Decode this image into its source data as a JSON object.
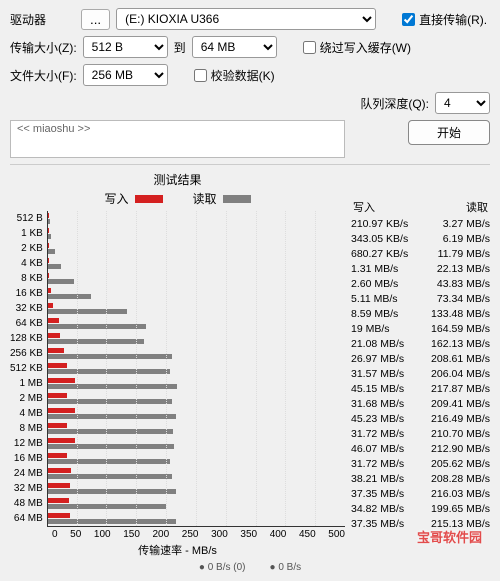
{
  "labels": {
    "drive": "驱动器",
    "transfer_size": "传输大小(Z):",
    "file_size": "文件大小(F):",
    "to": "到",
    "direct_transfer": "直接传输(R).",
    "bypass_write_cache": "绕过写入缓存(W)",
    "verify_data": "校验数据(K)",
    "queue_depth": "队列深度(Q):",
    "start": "开始",
    "write": "写入",
    "read": "读取",
    "test_results": "测试结果",
    "x_axis": "传输速率 - MB/s",
    "dots": "...",
    "desc_placeholder": "<< miaoshu >>",
    "footer_bps": "0 B/s (0)",
    "footer_bs": "0 B/s"
  },
  "values": {
    "drive_selected": "(E:) KIOXIA U366",
    "transfer_min": "512 B",
    "transfer_max": "64 MB",
    "file_size_selected": "256 MB",
    "queue_depth_selected": "4",
    "direct_transfer_checked": true,
    "bypass_checked": false,
    "verify_checked": false
  },
  "watermark": "宝哥软件园",
  "chart_data": {
    "type": "bar",
    "xlabel": "传输速率 - MB/s",
    "xlim": [
      0,
      500
    ],
    "xticks": [
      0,
      50,
      100,
      150,
      200,
      250,
      300,
      350,
      400,
      450,
      500
    ],
    "categories": [
      "512 B",
      "1 KB",
      "2 KB",
      "4 KB",
      "8 KB",
      "16 KB",
      "32 KB",
      "64 KB",
      "128 KB",
      "256 KB",
      "512 KB",
      "1 MB",
      "2 MB",
      "4 MB",
      "8 MB",
      "12 MB",
      "16 MB",
      "24 MB",
      "32 MB",
      "48 MB",
      "64 MB"
    ],
    "series": [
      {
        "name": "写入",
        "unit": "MB/s",
        "values": [
          0.21097,
          0.34305,
          0.68027,
          1.31,
          2.6,
          5.11,
          8.59,
          19,
          21.08,
          26.97,
          31.57,
          45.15,
          31.68,
          45.23,
          31.72,
          46.07,
          31.72,
          38.21,
          37.35,
          34.82,
          37.35
        ]
      },
      {
        "name": "读取",
        "unit": "MB/s",
        "values": [
          3.27,
          6.19,
          11.79,
          22.13,
          43.83,
          73.34,
          133.48,
          164.59,
          162.13,
          208.61,
          206.04,
          217.87,
          209.41,
          216.49,
          210.7,
          212.9,
          205.62,
          208.28,
          216.03,
          199.65,
          215.13
        ]
      }
    ],
    "display": [
      {
        "label": "512 B",
        "write": "210.97 KB/s",
        "read": "3.27 MB/s"
      },
      {
        "label": "1 KB",
        "write": "343.05 KB/s",
        "read": "6.19 MB/s"
      },
      {
        "label": "2 KB",
        "write": "680.27 KB/s",
        "read": "11.79 MB/s"
      },
      {
        "label": "4 KB",
        "write": "1.31 MB/s",
        "read": "22.13 MB/s"
      },
      {
        "label": "8 KB",
        "write": "2.60 MB/s",
        "read": "43.83 MB/s"
      },
      {
        "label": "16 KB",
        "write": "5.11 MB/s",
        "read": "73.34 MB/s"
      },
      {
        "label": "32 KB",
        "write": "8.59 MB/s",
        "read": "133.48 MB/s"
      },
      {
        "label": "64 KB",
        "write": "19 MB/s",
        "read": "164.59 MB/s"
      },
      {
        "label": "128 KB",
        "write": "21.08 MB/s",
        "read": "162.13 MB/s"
      },
      {
        "label": "256 KB",
        "write": "26.97 MB/s",
        "read": "208.61 MB/s"
      },
      {
        "label": "512 KB",
        "write": "31.57 MB/s",
        "read": "206.04 MB/s"
      },
      {
        "label": "1 MB",
        "write": "45.15 MB/s",
        "read": "217.87 MB/s"
      },
      {
        "label": "2 MB",
        "write": "31.68 MB/s",
        "read": "209.41 MB/s"
      },
      {
        "label": "4 MB",
        "write": "45.23 MB/s",
        "read": "216.49 MB/s"
      },
      {
        "label": "8 MB",
        "write": "31.72 MB/s",
        "read": "210.70 MB/s"
      },
      {
        "label": "12 MB",
        "write": "46.07 MB/s",
        "read": "212.90 MB/s"
      },
      {
        "label": "16 MB",
        "write": "31.72 MB/s",
        "read": "205.62 MB/s"
      },
      {
        "label": "24 MB",
        "write": "38.21 MB/s",
        "read": "208.28 MB/s"
      },
      {
        "label": "32 MB",
        "write": "37.35 MB/s",
        "read": "216.03 MB/s"
      },
      {
        "label": "48 MB",
        "write": "34.82 MB/s",
        "read": "199.65 MB/s"
      },
      {
        "label": "64 MB",
        "write": "37.35 MB/s",
        "read": "215.13 MB/s"
      }
    ]
  }
}
